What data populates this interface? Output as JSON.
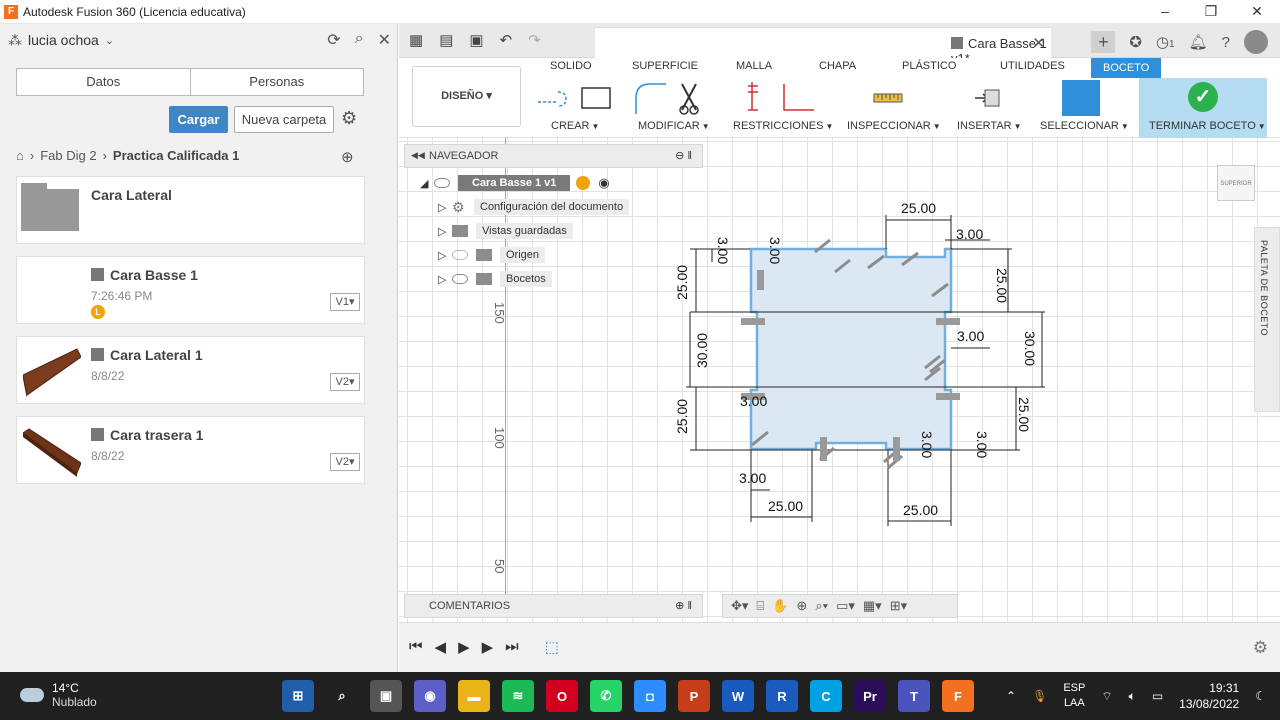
{
  "window": {
    "title": "Autodesk Fusion 360 (Licencia educativa)",
    "logo": "F"
  },
  "data_panel": {
    "user": "lucia ochoa",
    "tabs": [
      "Datos",
      "Personas"
    ],
    "upload_label": "Cargar",
    "new_folder_label": "Nueva carpeta",
    "breadcrumb": [
      "Fab Dig 2",
      "Practica Calificada 1"
    ],
    "items": [
      {
        "name": "Cara Lateral",
        "sub": "",
        "version": ""
      },
      {
        "name": "Cara Basse 1",
        "sub": "7:26:46 PM",
        "version": "V1"
      },
      {
        "name": "Cara Lateral 1",
        "sub": "8/8/22",
        "version": "V2"
      },
      {
        "name": "Cara trasera 1",
        "sub": "8/8/22",
        "version": "V2"
      }
    ]
  },
  "document_tab": {
    "title": "Cara Basse 1 v1*",
    "badge": "1"
  },
  "toolbar": {
    "workspace": "DISEÑO",
    "tabs": [
      "SOLIDO",
      "SUPERFICIE",
      "MALLA",
      "CHAPA",
      "PLÁSTICO",
      "UTILIDADES",
      "BOCETO"
    ],
    "active_tab": "BOCETO",
    "groups": [
      "CREAR",
      "MODIFICAR",
      "RESTRICCIONES",
      "INSPECCIONAR",
      "INSERTAR",
      "SELECCIONAR",
      "TERMINAR BOCETO"
    ],
    "accent": "#2f8fd8",
    "finish_color": "#2bb24c"
  },
  "navigator": {
    "title": "NAVEGADOR",
    "root": "Cara Basse 1 v1",
    "nodes": [
      "Configuración del documento",
      "Vistas guardadas",
      "Origen",
      "Bocetos"
    ]
  },
  "canvas": {
    "ruler_labels": [
      "150",
      "100",
      "50"
    ],
    "viewcube_label": "SUPERIOR",
    "palette_label": "PALETA DE BOCETO",
    "dims": {
      "top": "25.00",
      "top_right_small": "3.00",
      "right_top": "25.00",
      "right_mid": "30.00",
      "right_mid_small": "3.00",
      "right_bottom": "25.00",
      "left_top": "25.00",
      "left_mid": "30.00",
      "left_bottom": "25.00",
      "left_top_small1": "3.00",
      "left_top_small2": "3.00",
      "left_bottom_small": "3.00",
      "bottom_small_left": "3.00",
      "bottom_left": "25.00",
      "bottom_right": "25.00",
      "bottom_small_mid": "3.00",
      "bottom_small_right": "3.00"
    }
  },
  "comments_label": "COMENTARIOS",
  "taskbar": {
    "temp": "14°C",
    "weather": "Nublado",
    "lang1": "ESP",
    "lang2": "LAA",
    "time": "19:31",
    "date": "13/08/2022"
  }
}
